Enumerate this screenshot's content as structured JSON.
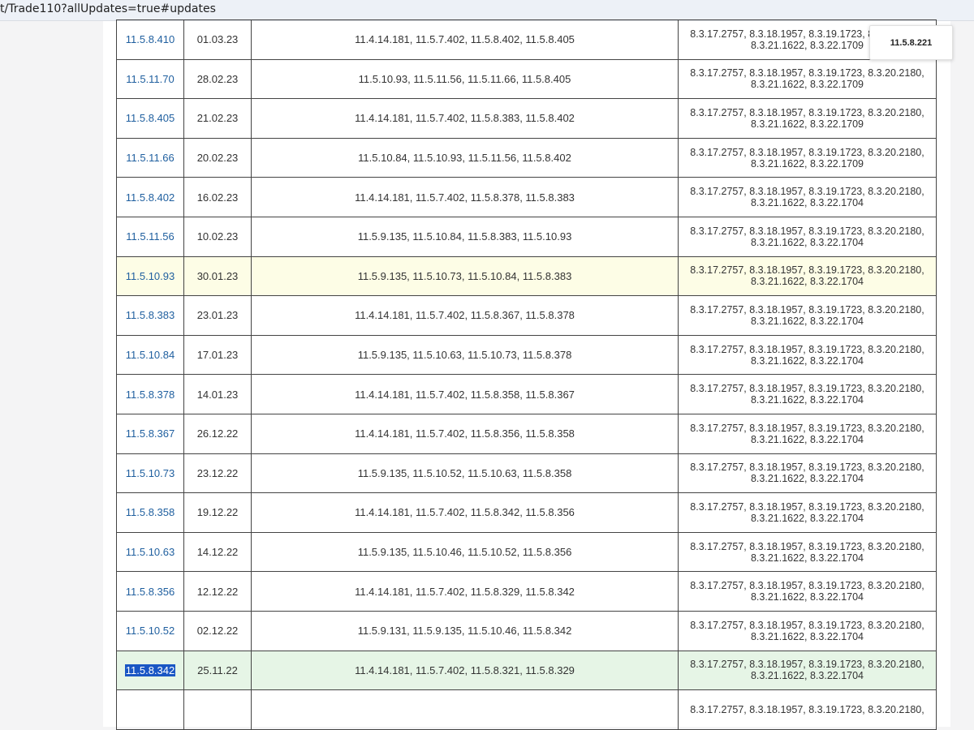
{
  "browser": {
    "url": "t/Trade110?allUpdates=true#updates"
  },
  "tooltip": {
    "text": "11.5.8.221"
  },
  "table": {
    "rows": [
      {
        "version": "11.5.8.410",
        "date": "01.03.23",
        "previous": "11.4.14.181, 11.5.7.402, 11.5.8.402, 11.5.8.405",
        "platform_line1": "8.3.17.2757, 8.3.18.1957, 8.3.19.1723, 8.3.20.2180,",
        "platform_line2": "8.3.21.1622, 8.3.22.1709"
      },
      {
        "version": "11.5.11.70",
        "date": "28.02.23",
        "previous": "11.5.10.93, 11.5.11.56, 11.5.11.66, 11.5.8.405",
        "platform_line1": "8.3.17.2757, 8.3.18.1957, 8.3.19.1723, 8.3.20.2180,",
        "platform_line2": "8.3.21.1622, 8.3.22.1709"
      },
      {
        "version": "11.5.8.405",
        "date": "21.02.23",
        "previous": "11.4.14.181, 11.5.7.402, 11.5.8.383, 11.5.8.402",
        "platform_line1": "8.3.17.2757, 8.3.18.1957, 8.3.19.1723, 8.3.20.2180,",
        "platform_line2": "8.3.21.1622, 8.3.22.1709"
      },
      {
        "version": "11.5.11.66",
        "date": "20.02.23",
        "previous": "11.5.10.84, 11.5.10.93, 11.5.11.56, 11.5.8.402",
        "platform_line1": "8.3.17.2757, 8.3.18.1957, 8.3.19.1723, 8.3.20.2180,",
        "platform_line2": "8.3.21.1622, 8.3.22.1709"
      },
      {
        "version": "11.5.8.402",
        "date": "16.02.23",
        "previous": "11.4.14.181, 11.5.7.402, 11.5.8.378, 11.5.8.383",
        "platform_line1": "8.3.17.2757, 8.3.18.1957, 8.3.19.1723, 8.3.20.2180,",
        "platform_line2": "8.3.21.1622, 8.3.22.1704"
      },
      {
        "version": "11.5.11.56",
        "date": "10.02.23",
        "previous": "11.5.9.135, 11.5.10.84, 11.5.8.383, 11.5.10.93",
        "platform_line1": "8.3.17.2757, 8.3.18.1957, 8.3.19.1723, 8.3.20.2180,",
        "platform_line2": "8.3.21.1622, 8.3.22.1704"
      },
      {
        "version": "11.5.10.93",
        "date": "30.01.23",
        "previous": "11.5.9.135, 11.5.10.73, 11.5.10.84, 11.5.8.383",
        "platform_line1": "8.3.17.2757, 8.3.18.1957, 8.3.19.1723, 8.3.20.2180,",
        "platform_line2": "8.3.21.1622, 8.3.22.1704",
        "highlight": "yellow"
      },
      {
        "version": "11.5.8.383",
        "date": "23.01.23",
        "previous": "11.4.14.181, 11.5.7.402, 11.5.8.367, 11.5.8.378",
        "platform_line1": "8.3.17.2757, 8.3.18.1957, 8.3.19.1723, 8.3.20.2180,",
        "platform_line2": "8.3.21.1622, 8.3.22.1704"
      },
      {
        "version": "11.5.10.84",
        "date": "17.01.23",
        "previous": "11.5.9.135, 11.5.10.63, 11.5.10.73, 11.5.8.378",
        "platform_line1": "8.3.17.2757, 8.3.18.1957, 8.3.19.1723, 8.3.20.2180,",
        "platform_line2": "8.3.21.1622, 8.3.22.1704"
      },
      {
        "version": "11.5.8.378",
        "date": "14.01.23",
        "previous": "11.4.14.181, 11.5.7.402, 11.5.8.358, 11.5.8.367",
        "platform_line1": "8.3.17.2757, 8.3.18.1957, 8.3.19.1723, 8.3.20.2180,",
        "platform_line2": "8.3.21.1622, 8.3.22.1704"
      },
      {
        "version": "11.5.8.367",
        "date": "26.12.22",
        "previous": "11.4.14.181, 11.5.7.402, 11.5.8.356, 11.5.8.358",
        "platform_line1": "8.3.17.2757, 8.3.18.1957, 8.3.19.1723, 8.3.20.2180,",
        "platform_line2": "8.3.21.1622, 8.3.22.1704"
      },
      {
        "version": "11.5.10.73",
        "date": "23.12.22",
        "previous": "11.5.9.135, 11.5.10.52, 11.5.10.63, 11.5.8.358",
        "platform_line1": "8.3.17.2757, 8.3.18.1957, 8.3.19.1723, 8.3.20.2180,",
        "platform_line2": "8.3.21.1622, 8.3.22.1704"
      },
      {
        "version": "11.5.8.358",
        "date": "19.12.22",
        "previous": "11.4.14.181, 11.5.7.402, 11.5.8.342, 11.5.8.356",
        "platform_line1": "8.3.17.2757, 8.3.18.1957, 8.3.19.1723, 8.3.20.2180,",
        "platform_line2": "8.3.21.1622, 8.3.22.1704"
      },
      {
        "version": "11.5.10.63",
        "date": "14.12.22",
        "previous": "11.5.9.135, 11.5.10.46, 11.5.10.52, 11.5.8.356",
        "platform_line1": "8.3.17.2757, 8.3.18.1957, 8.3.19.1723, 8.3.20.2180,",
        "platform_line2": "8.3.21.1622, 8.3.22.1704"
      },
      {
        "version": "11.5.8.356",
        "date": "12.12.22",
        "previous": "11.4.14.181, 11.5.7.402, 11.5.8.329, 11.5.8.342",
        "platform_line1": "8.3.17.2757, 8.3.18.1957, 8.3.19.1723, 8.3.20.2180,",
        "platform_line2": "8.3.21.1622, 8.3.22.1704"
      },
      {
        "version": "11.5.10.52",
        "date": "02.12.22",
        "previous": "11.5.9.131, 11.5.9.135, 11.5.10.46, 11.5.8.342",
        "platform_line1": "8.3.17.2757, 8.3.18.1957, 8.3.19.1723, 8.3.20.2180,",
        "platform_line2": "8.3.21.1622, 8.3.22.1704"
      },
      {
        "version": "11.5.8.342",
        "date": "25.11.22",
        "previous": "11.4.14.181, 11.5.7.402, 11.5.8.321, 11.5.8.329",
        "platform_line1": "8.3.17.2757, 8.3.18.1957, 8.3.19.1723, 8.3.20.2180,",
        "platform_line2": "8.3.21.1622, 8.3.22.1704",
        "highlight": "green",
        "selected": true
      },
      {
        "version": "",
        "date": "",
        "previous": "",
        "platform_line1": "8.3.17.2757, 8.3.18.1957, 8.3.19.1723, 8.3.20.2180,",
        "platform_line2": ""
      }
    ]
  },
  "colors": {
    "link": "#1f5f9f",
    "highlight_yellow": "#fdfde6",
    "highlight_green": "#e6f5e6",
    "selection": "#1a56c4",
    "border": "#444444"
  }
}
